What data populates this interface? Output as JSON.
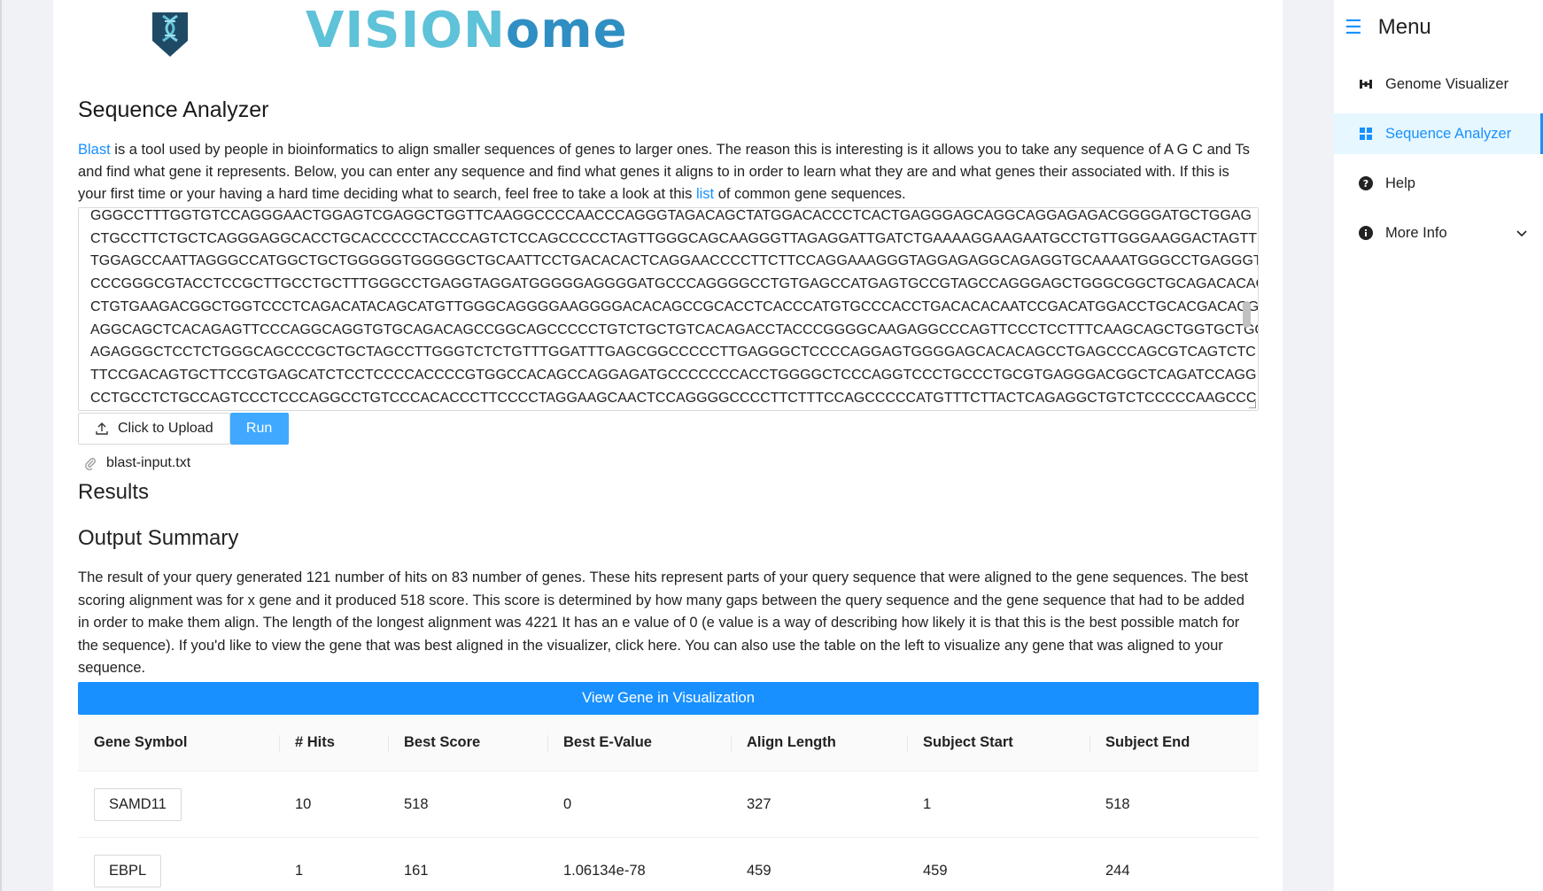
{
  "brand": {
    "part1": "VISION",
    "part2": "ome"
  },
  "page_title": "Sequence Analyzer",
  "intro": {
    "link1": "Blast",
    "text1": " is a tool used by people in bioinformatics to align smaller sequences of genes to larger ones. The reason this is interesting is it allows you to take any sequence of A G C and Ts and find what gene it represents. Below, you can enter any sequence and find what genes it aligns to in order to learn what they are and what genes their associated with. If this is your first time or your having a hard time deciding what to search, feel free to take a look at this ",
    "link2": "list",
    "text2": " of common gene sequences."
  },
  "sequence": "GGGCCTTTGGTGTCCAGGGAACTGGAGTCGAGGCTGGTTCAAGGCCCCAACCCAGGGTAGACAGCTATGGACACCCTCACTGAGGGAGCAGGCAGGAGAGACGGGGATGCTGGAG\nCTGCCTTCTGCTCAGGGAGGCACCTGCACCCCCTACCCAGTCTCCAGCCCCCTAGTTGGGCAGCAAGGGTTAGAGGATTGATCTGAAAAGGAAGAATGCCTGTTGGGAAGGACTAGTT\nTGGAGCCAATTAGGGCCATGGCTGCTGGGGGTGGGGGCTGCAATTCCTGACACACTCAGGAACCCCTTCTTCCAGGAAAGGGTAGGAGAGGCAGAGGTGCAAAATGGGCCTGAGGGT\nCCCGGGCGTACCTCCGCTTGCCTGCTTTGGGCCTGAGGTAGGATGGGGGAGGGGATGCCCAGGGGCCTGTGAGCCATGAGTGCCGTAGCCAGGGAGCTGGGCGGCTGCAGACACAC\nCTGTGAAGACGGCTGGTCCCTCAGACATACAGCATGTTGGGCAGGGGAAGGGGACACAGCCGCACCTCACCCATGTGCCCACCTGACACACAATCCGACATGGACCTGCACGACAGGC\nAGGCAGCTCACAGAGTTCCCAGGCAGGTGTGCAGACAGCCGGCAGCCCCCTGTCTGCTGTCACAGACCTACCCGGGGCAAGAGGCCCAGTTCCCTCCTTTCAAGCAGCTGGTGCTGG\nAGAGGGCTCCTCTGGGCAGCCCGCTGCTAGCCTTGGGTCTCTGTTTGGATTTGAGCGGCCCCCTTGAGGGCTCCCCAGGAGTGGGGAGCACACAGCCTGAGCCCAGCGTCAGTCTC\nTTCCGACAGTGCTTCCGTGAGCATCTCCTCCCCACCCCGTGGCCACAGCCAGGAGATGCCCCCCCACCTGGGGCTCCCAGGTCCCTGCCCTGCGTGAGGGACGGCTCAGATCCAGG\nCCTGCCTCTGCCAGTCCCTCCCAGGCCTGTCCCACACCCTTCCCCTAGGAAGCAACTCCAGGGGCCCCTTCTTTCCAGCCCCCATGTTTCTTACTCAGAGGCTGTCTCCCCCAAGCCC",
  "upload": {
    "label": "Click to Upload"
  },
  "run": {
    "label": "Run"
  },
  "file": {
    "name": "blast-input.txt"
  },
  "results_title": "Results",
  "summary_title": "Output Summary",
  "summary_text": "The result of your query generated 121 number of hits on 83 number of genes. These hits represent parts of your query sequence that were aligned to the gene sequences. The best scoring alignment was for x gene and it produced 518 score. This score is determined by how many gaps between the query sequence and the gene sequence that had to be added in order to make them align. The length of the longest alignment was 4221 It has an e value of 0 (e value is a way of describing how likely it is that this is the best possible match for the sequence). If you'd like to view the gene that was best aligned in the visualizer, click here. You can also use the table on the left to visualize any gene that was aligned to your sequence.",
  "view_button": "View Gene in Visualization",
  "table": {
    "headers": [
      "Gene Symbol",
      "# Hits",
      "Best Score",
      "Best E-Value",
      "Align Length",
      "Subject Start",
      "Subject End"
    ],
    "rows": [
      [
        "SAMD11",
        "10",
        "518",
        "0",
        "327",
        "1",
        "518"
      ],
      [
        "EBPL",
        "1",
        "161",
        "1.06134e-78",
        "459",
        "459",
        "244"
      ]
    ]
  },
  "menu": {
    "title": "Menu",
    "items": [
      {
        "label": "Genome Visualizer",
        "icon": "genome-icon"
      },
      {
        "label": "Sequence Analyzer",
        "icon": "grid-icon"
      },
      {
        "label": "Help",
        "icon": "question-icon"
      },
      {
        "label": "More Info",
        "icon": "info-icon"
      }
    ]
  },
  "colors": {
    "accent": "#1890ff",
    "run": "#40a9ff",
    "brand_light": "#5ec2d8",
    "brand_dark": "#2f8ec2"
  }
}
